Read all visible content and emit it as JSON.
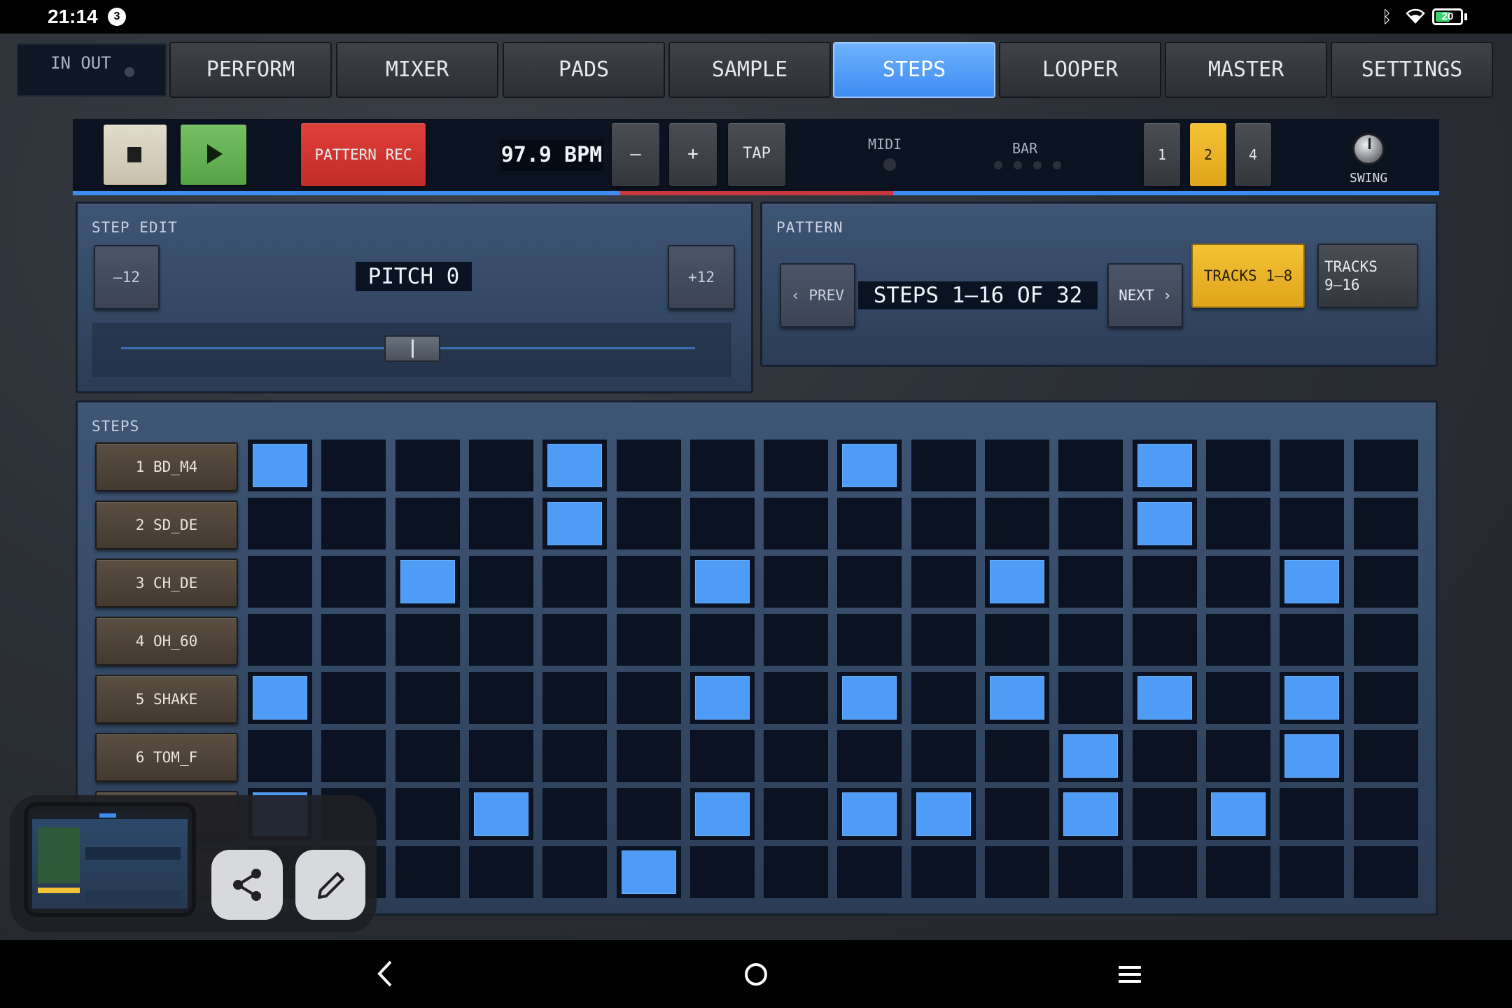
{
  "status": {
    "time": "21:14",
    "notification_count": "3",
    "battery": "20"
  },
  "inout": {
    "label": "IN OUT"
  },
  "tabs": [
    {
      "label": "PERFORM",
      "active": false
    },
    {
      "label": "MIXER",
      "active": false
    },
    {
      "label": "PADS",
      "active": false
    },
    {
      "label": "SAMPLE",
      "active": false
    },
    {
      "label": "STEPS",
      "active": true
    },
    {
      "label": "LOOPER",
      "active": false
    },
    {
      "label": "MASTER",
      "active": false
    },
    {
      "label": "SETTINGS",
      "active": false
    }
  ],
  "transport": {
    "pattern_rec": "PATTERN REC",
    "bpm": "97.9 BPM",
    "minus": "–",
    "plus": "+",
    "tap": "TAP",
    "midi_label": "MIDI",
    "bar_label": "BAR",
    "bar_options": [
      "1",
      "2",
      "4"
    ],
    "bar_selected": "2",
    "swing_label": "SWING"
  },
  "step_edit": {
    "title": "STEP EDIT",
    "minus12": "–12",
    "plus12": "+12",
    "pitch": "PITCH 0",
    "slider_value": 0.5
  },
  "pattern": {
    "title": "PATTERN",
    "prev": "‹ PREV",
    "range": "STEPS 1–16 OF 32",
    "next": "NEXT ›",
    "tracks_a": "TRACKS 1–8",
    "tracks_b_line1": "TRACKS",
    "tracks_b_line2": "9–16",
    "tracks_selected": "TRACKS 1–8"
  },
  "steps": {
    "title": "STEPS",
    "tracks": [
      "1  BD_M4",
      "2  SD_DE",
      "3  CH_DE",
      "4  OH_60",
      "5  SHAKE",
      "6  TOM_F",
      "",
      ""
    ],
    "grid": [
      [
        1,
        0,
        0,
        0,
        1,
        0,
        0,
        0,
        1,
        0,
        0,
        0,
        1,
        0,
        0,
        0
      ],
      [
        0,
        0,
        0,
        0,
        1,
        0,
        0,
        0,
        0,
        0,
        0,
        0,
        1,
        0,
        0,
        0
      ],
      [
        0,
        0,
        1,
        0,
        0,
        0,
        1,
        0,
        0,
        0,
        1,
        0,
        0,
        0,
        1,
        0
      ],
      [
        0,
        0,
        0,
        0,
        0,
        0,
        0,
        0,
        0,
        0,
        0,
        0,
        0,
        0,
        0,
        0
      ],
      [
        1,
        0,
        0,
        0,
        0,
        0,
        1,
        0,
        1,
        0,
        1,
        0,
        1,
        0,
        1,
        0
      ],
      [
        0,
        0,
        0,
        0,
        0,
        0,
        0,
        0,
        0,
        0,
        0,
        1,
        0,
        0,
        1,
        0
      ],
      [
        1,
        0,
        0,
        1,
        0,
        0,
        1,
        0,
        1,
        1,
        0,
        1,
        0,
        1,
        0,
        0
      ],
      [
        0,
        0,
        0,
        0,
        0,
        1,
        0,
        0,
        0,
        0,
        0,
        0,
        0,
        0,
        0,
        0
      ]
    ]
  },
  "colors": {
    "accent_blue": "#4e9cf5",
    "active_yellow": "#f4c235",
    "record_red": "#e0403a",
    "play_green": "#74c063"
  },
  "icons": {
    "share": "share-icon",
    "edit": "pencil-icon",
    "nav_back": "back-icon",
    "nav_home": "home-icon",
    "nav_menu": "menu-icon"
  }
}
